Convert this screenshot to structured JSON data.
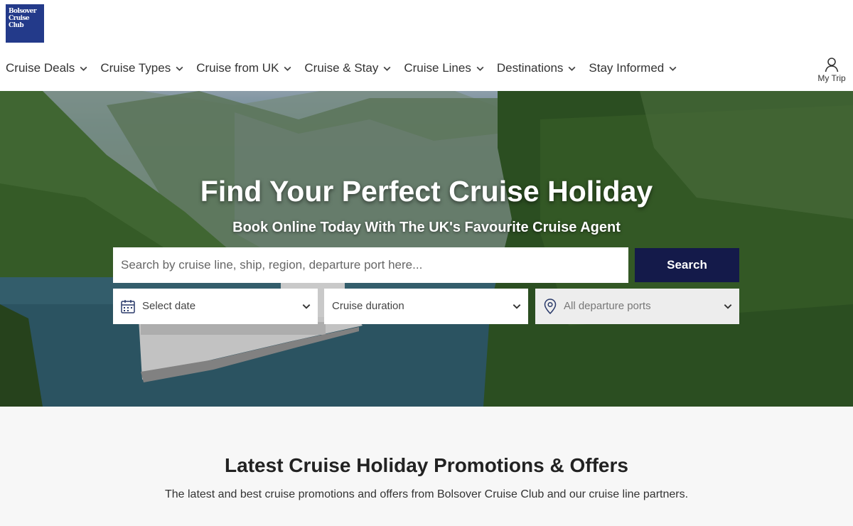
{
  "brand": {
    "logo_lines": [
      "Bolsover",
      "Cruise",
      "Club"
    ],
    "logo_color": "#233a8a"
  },
  "nav": {
    "items": [
      {
        "label": "Cruise Deals",
        "icon": "chevron-down-icon"
      },
      {
        "label": "Cruise Types",
        "icon": "chevron-down-icon"
      },
      {
        "label": "Cruise from UK",
        "icon": "chevron-down-icon"
      },
      {
        "label": "Cruise & Stay",
        "icon": "chevron-down-icon"
      },
      {
        "label": "Cruise Lines",
        "icon": "chevron-down-icon"
      },
      {
        "label": "Destinations",
        "icon": "chevron-down-icon"
      },
      {
        "label": "Stay Informed",
        "icon": "chevron-down-icon"
      }
    ],
    "my_trip": {
      "label": "My Trip",
      "icon": "user-icon"
    }
  },
  "hero": {
    "title": "Find Your Perfect Cruise Holiday",
    "subtitle": "Book Online Today With The UK's Favourite Cruise Agent",
    "search": {
      "placeholder": "Search by cruise line, ship, region, departure port here...",
      "value": "",
      "button_label": "Search",
      "button_color": "#141a4a"
    },
    "filters": {
      "date": {
        "label": "Select date",
        "icon": "calendar-icon"
      },
      "duration": {
        "label": "Cruise duration"
      },
      "ports": {
        "label": "All departure ports",
        "icon": "location-pin-icon"
      }
    }
  },
  "promotions": {
    "title": "Latest Cruise Holiday Promotions & Offers",
    "subtitle": "The latest and best cruise promotions and offers from Bolsover Cruise Club and our cruise line partners."
  }
}
